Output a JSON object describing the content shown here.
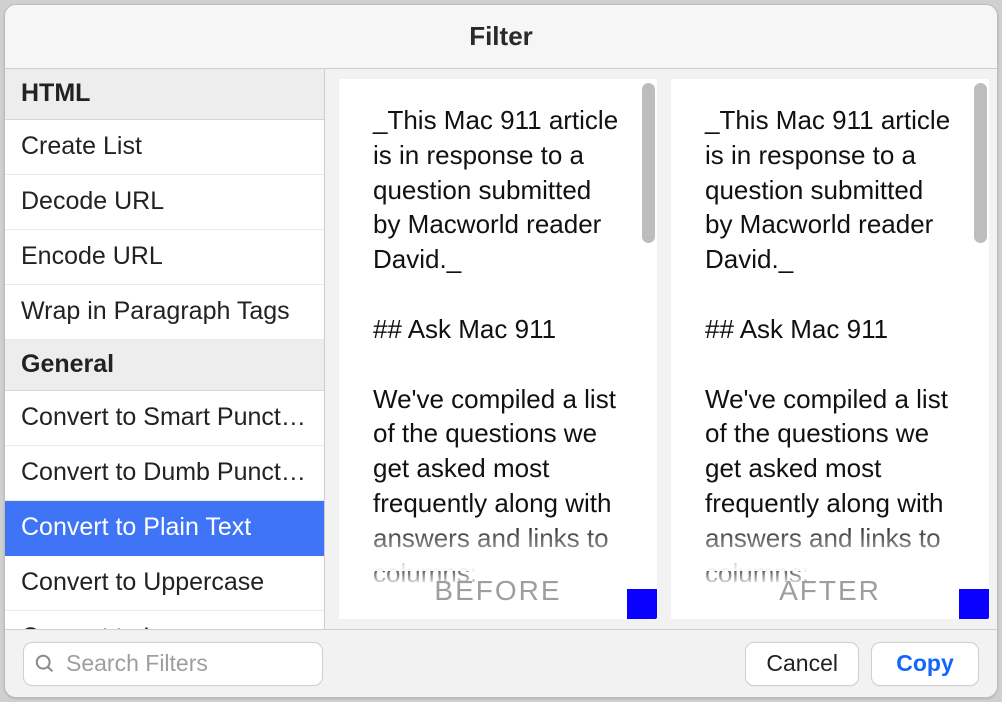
{
  "window": {
    "title": "Filter"
  },
  "sidebar": {
    "sections": [
      {
        "header": "HTML",
        "items": [
          {
            "label": "Create List",
            "selected": false
          },
          {
            "label": "Decode URL",
            "selected": false
          },
          {
            "label": "Encode URL",
            "selected": false
          },
          {
            "label": "Wrap in Paragraph Tags",
            "selected": false
          }
        ]
      },
      {
        "header": "General",
        "items": [
          {
            "label": "Convert to Smart Punctuation",
            "selected": false
          },
          {
            "label": "Convert to Dumb Punctuation",
            "selected": false
          },
          {
            "label": "Convert to Plain Text",
            "selected": true
          },
          {
            "label": "Convert to Uppercase",
            "selected": false
          },
          {
            "label": "Convert to Lowercase",
            "selected": false
          }
        ]
      }
    ]
  },
  "preview": {
    "before_label": "BEFORE",
    "after_label": "AFTER",
    "before_text": "_This Mac 911 article is in response to a question submitted by Macworld reader David._\n\n## Ask Mac 911\n\nWe've compiled a list of the questions we get asked most frequently along with answers and links to columns:",
    "after_text": "_This Mac 911 article is in response to a question submitted by Macworld reader David._\n\n## Ask Mac 911\n\nWe've compiled a list of the questions we get asked most frequently along with answers and links to columns:"
  },
  "bottombar": {
    "search_placeholder": "Search Filters",
    "cancel_label": "Cancel",
    "copy_label": "Copy"
  }
}
